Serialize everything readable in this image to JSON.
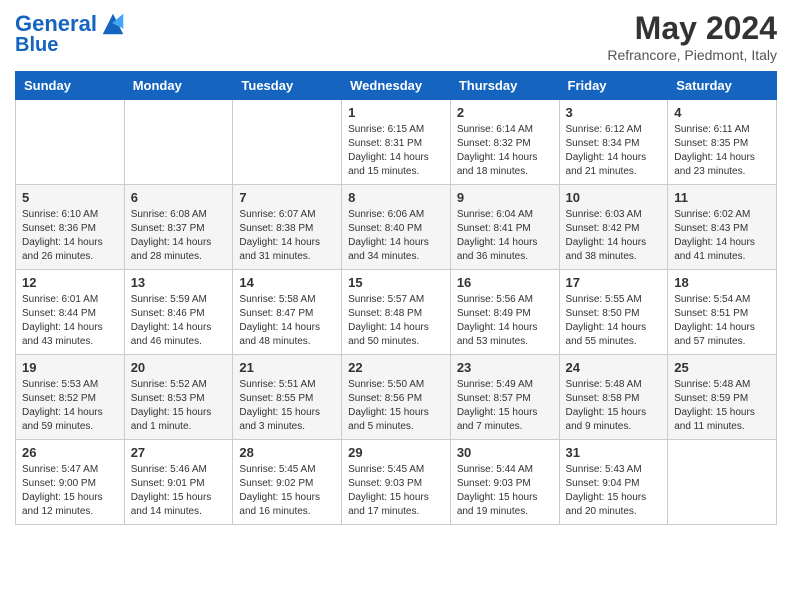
{
  "header": {
    "logo_line1": "General",
    "logo_line2": "Blue",
    "month_title": "May 2024",
    "subtitle": "Refrancore, Piedmont, Italy"
  },
  "days_of_week": [
    "Sunday",
    "Monday",
    "Tuesday",
    "Wednesday",
    "Thursday",
    "Friday",
    "Saturday"
  ],
  "weeks": [
    [
      {
        "day": "",
        "info": ""
      },
      {
        "day": "",
        "info": ""
      },
      {
        "day": "",
        "info": ""
      },
      {
        "day": "1",
        "info": "Sunrise: 6:15 AM\nSunset: 8:31 PM\nDaylight: 14 hours\nand 15 minutes."
      },
      {
        "day": "2",
        "info": "Sunrise: 6:14 AM\nSunset: 8:32 PM\nDaylight: 14 hours\nand 18 minutes."
      },
      {
        "day": "3",
        "info": "Sunrise: 6:12 AM\nSunset: 8:34 PM\nDaylight: 14 hours\nand 21 minutes."
      },
      {
        "day": "4",
        "info": "Sunrise: 6:11 AM\nSunset: 8:35 PM\nDaylight: 14 hours\nand 23 minutes."
      }
    ],
    [
      {
        "day": "5",
        "info": "Sunrise: 6:10 AM\nSunset: 8:36 PM\nDaylight: 14 hours\nand 26 minutes."
      },
      {
        "day": "6",
        "info": "Sunrise: 6:08 AM\nSunset: 8:37 PM\nDaylight: 14 hours\nand 28 minutes."
      },
      {
        "day": "7",
        "info": "Sunrise: 6:07 AM\nSunset: 8:38 PM\nDaylight: 14 hours\nand 31 minutes."
      },
      {
        "day": "8",
        "info": "Sunrise: 6:06 AM\nSunset: 8:40 PM\nDaylight: 14 hours\nand 34 minutes."
      },
      {
        "day": "9",
        "info": "Sunrise: 6:04 AM\nSunset: 8:41 PM\nDaylight: 14 hours\nand 36 minutes."
      },
      {
        "day": "10",
        "info": "Sunrise: 6:03 AM\nSunset: 8:42 PM\nDaylight: 14 hours\nand 38 minutes."
      },
      {
        "day": "11",
        "info": "Sunrise: 6:02 AM\nSunset: 8:43 PM\nDaylight: 14 hours\nand 41 minutes."
      }
    ],
    [
      {
        "day": "12",
        "info": "Sunrise: 6:01 AM\nSunset: 8:44 PM\nDaylight: 14 hours\nand 43 minutes."
      },
      {
        "day": "13",
        "info": "Sunrise: 5:59 AM\nSunset: 8:46 PM\nDaylight: 14 hours\nand 46 minutes."
      },
      {
        "day": "14",
        "info": "Sunrise: 5:58 AM\nSunset: 8:47 PM\nDaylight: 14 hours\nand 48 minutes."
      },
      {
        "day": "15",
        "info": "Sunrise: 5:57 AM\nSunset: 8:48 PM\nDaylight: 14 hours\nand 50 minutes."
      },
      {
        "day": "16",
        "info": "Sunrise: 5:56 AM\nSunset: 8:49 PM\nDaylight: 14 hours\nand 53 minutes."
      },
      {
        "day": "17",
        "info": "Sunrise: 5:55 AM\nSunset: 8:50 PM\nDaylight: 14 hours\nand 55 minutes."
      },
      {
        "day": "18",
        "info": "Sunrise: 5:54 AM\nSunset: 8:51 PM\nDaylight: 14 hours\nand 57 minutes."
      }
    ],
    [
      {
        "day": "19",
        "info": "Sunrise: 5:53 AM\nSunset: 8:52 PM\nDaylight: 14 hours\nand 59 minutes."
      },
      {
        "day": "20",
        "info": "Sunrise: 5:52 AM\nSunset: 8:53 PM\nDaylight: 15 hours\nand 1 minute."
      },
      {
        "day": "21",
        "info": "Sunrise: 5:51 AM\nSunset: 8:55 PM\nDaylight: 15 hours\nand 3 minutes."
      },
      {
        "day": "22",
        "info": "Sunrise: 5:50 AM\nSunset: 8:56 PM\nDaylight: 15 hours\nand 5 minutes."
      },
      {
        "day": "23",
        "info": "Sunrise: 5:49 AM\nSunset: 8:57 PM\nDaylight: 15 hours\nand 7 minutes."
      },
      {
        "day": "24",
        "info": "Sunrise: 5:48 AM\nSunset: 8:58 PM\nDaylight: 15 hours\nand 9 minutes."
      },
      {
        "day": "25",
        "info": "Sunrise: 5:48 AM\nSunset: 8:59 PM\nDaylight: 15 hours\nand 11 minutes."
      }
    ],
    [
      {
        "day": "26",
        "info": "Sunrise: 5:47 AM\nSunset: 9:00 PM\nDaylight: 15 hours\nand 12 minutes."
      },
      {
        "day": "27",
        "info": "Sunrise: 5:46 AM\nSunset: 9:01 PM\nDaylight: 15 hours\nand 14 minutes."
      },
      {
        "day": "28",
        "info": "Sunrise: 5:45 AM\nSunset: 9:02 PM\nDaylight: 15 hours\nand 16 minutes."
      },
      {
        "day": "29",
        "info": "Sunrise: 5:45 AM\nSunset: 9:03 PM\nDaylight: 15 hours\nand 17 minutes."
      },
      {
        "day": "30",
        "info": "Sunrise: 5:44 AM\nSunset: 9:03 PM\nDaylight: 15 hours\nand 19 minutes."
      },
      {
        "day": "31",
        "info": "Sunrise: 5:43 AM\nSunset: 9:04 PM\nDaylight: 15 hours\nand 20 minutes."
      },
      {
        "day": "",
        "info": ""
      }
    ]
  ]
}
